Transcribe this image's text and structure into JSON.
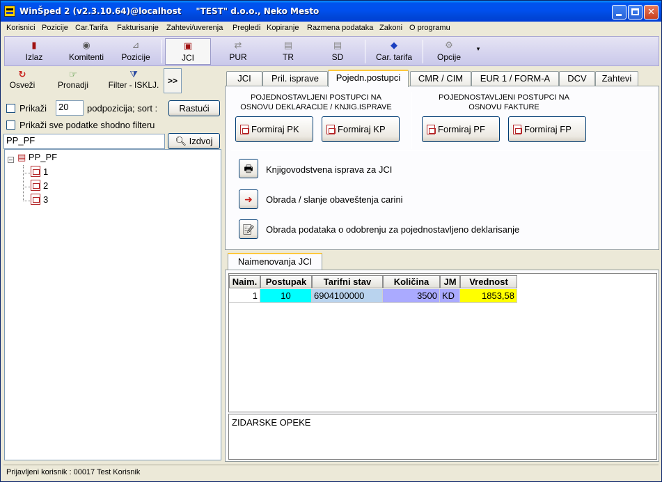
{
  "window": {
    "title": "WinŠped 2 (v2.3.10.64)@localhost     \"TEST\" d.o.o., Neko Mesto"
  },
  "menu": [
    "Korisnici",
    "Pozicije",
    "Car.Tarifa",
    "Fakturisanje",
    "Zahtevi/uverenja",
    "Pregledi",
    "Kopiranje",
    "Razmena podataka",
    "Zakoni",
    "O programu"
  ],
  "toolbar": {
    "izlaz": "Izlaz",
    "komitenti": "Komitenti",
    "pozicije": "Pozicije",
    "jci": "JCI",
    "pur": "PUR",
    "tr": "TR",
    "sd": "SD",
    "car_tarifa": "Car. tarifa",
    "opcije": "Opcije"
  },
  "left": {
    "osvezi": "Osveži",
    "pronadji": "Pronadji",
    "filter": "Filter - ISKLJ.",
    "more": ">>",
    "prikazi_label": "Prikaži",
    "prikazi_count": "20",
    "podpozicija_label": "podpozicija; sort :",
    "sort_button": "Rastući",
    "filter_all_label": "Prikaži sve podatke shodno filteru",
    "search_value": "PP_PF",
    "izdvoj_button": "Izdvoj",
    "tree": {
      "root": "PP_PF",
      "children": [
        "1",
        "2",
        "3"
      ]
    }
  },
  "tabs": [
    "JCI",
    "Pril. isprave",
    "Pojedn.postupci",
    "CMR / CIM",
    "EUR 1 / FORM-A",
    "DCV",
    "Zahtevi"
  ],
  "panel": {
    "left_title_1": "POJEDNOSTAVLJENI POSTUPCI NA",
    "left_title_2": "OSNOVU DEKLARACIJE / KNJIG.ISPRAVE",
    "right_title_1": "POJEDNOSTAVLJENI POSTUPCI NA",
    "right_title_2": "OSNOVU FAKTURE",
    "btn_pk": "Formiraj PK",
    "btn_kp": "Formiraj KP",
    "btn_pf": "Formiraj PF",
    "btn_fp": "Formiraj FP",
    "action_1": "Knjigovodstvena isprava za JCI",
    "action_2": "Obrada / slanje obaveštenja carini",
    "action_3": "Obrada podataka o odobrenju za pojednostavljeno deklarisanje"
  },
  "subtab": "Naimenovanja JCI",
  "grid": {
    "columns": [
      "Naim.",
      "Postupak",
      "Tarifni stav",
      "Količina",
      "JM",
      "Vrednost"
    ],
    "rows": [
      [
        "1",
        "10",
        "6904100000",
        "3500",
        "KD",
        "1853,58"
      ]
    ]
  },
  "memo": "ZIDARSKE OPEKE",
  "status": "Prijavljeni korisnik : 00017 Test Korisnik"
}
